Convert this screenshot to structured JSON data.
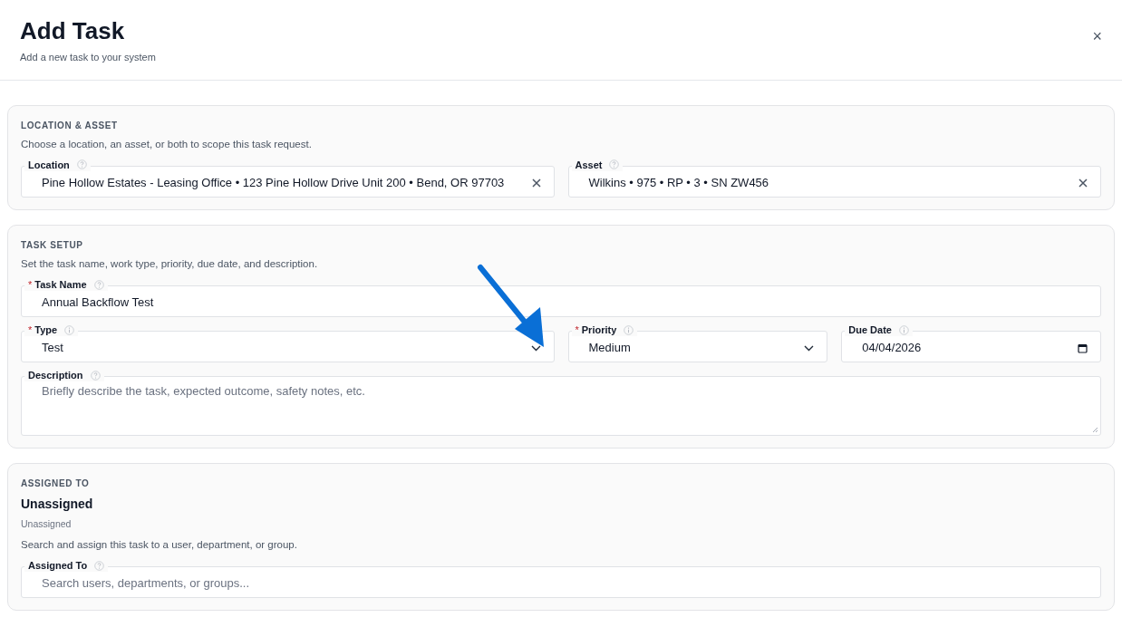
{
  "header": {
    "title": "Add Task",
    "subtitle": "Add a new task to your system",
    "close": "×"
  },
  "sections": [
    {
      "kind": "pair",
      "heading": "LOCATION & ASSET",
      "description": "Choose a location, an asset, or both to scope this task request.",
      "fields": [
        {
          "kind": "clearable",
          "label": "Location",
          "value": "Pine Hollow Estates - Leasing Office • 123 Pine Hollow Drive Unit 200 • Bend, OR 97703"
        },
        {
          "kind": "clearable",
          "label": "Asset",
          "value": "Wilkins • 975 • RP • 3 • SN ZW456"
        }
      ]
    },
    {
      "kind": "setup",
      "heading": "TASK SETUP",
      "description": "Set the task name, work type, priority, due date, and description.",
      "fields": [
        {
          "kind": "text",
          "marker": "*",
          "label": "Task Name",
          "value": "Annual Backflow Test"
        },
        {
          "kind": "select",
          "marker": "*",
          "label": "Type",
          "value": "Test"
        },
        {
          "kind": "select",
          "marker": "*",
          "label": "Priority",
          "value": "Medium"
        },
        {
          "kind": "date",
          "label": "Due Date",
          "value": "04/04/2026"
        },
        {
          "kind": "textarea",
          "label": "Description",
          "placeholder": "Briefly describe the task, expected outcome, safety notes, etc."
        }
      ]
    },
    {
      "kind": "single",
      "heading": "ASSIGNED TO",
      "assignee": "Unassigned",
      "assignee_note": "Unassigned",
      "description": "Search and assign this task to a user, department, or group.",
      "fields": [
        {
          "kind": "search",
          "label": "Assigned To",
          "placeholder": "Search users, departments, or groups..."
        }
      ]
    }
  ]
}
